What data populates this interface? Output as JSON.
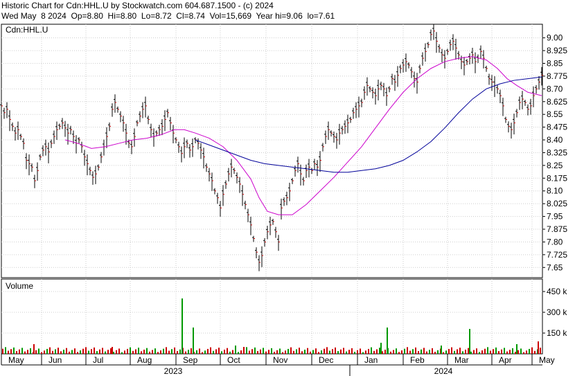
{
  "header": {
    "line1": "Historic Chart for Cdn:HHL.U by Stockwatch.com 604.687.1500 - (c) 2024",
    "line2": "Wed May  8 2024  Op=8.80  Hi=8.80  Lo=8.72  Cl=8.74  Vol=15,669  Year hi=9.06  lo=7.61"
  },
  "chart_data": [
    {
      "type": "line",
      "title": "Cdn:HHL.U",
      "y_ticks": [
        "9.00",
        "8.925",
        "8.85",
        "8.775",
        "8.70",
        "8.625",
        "8.55",
        "8.475",
        "8.40",
        "8.325",
        "8.25",
        "8.175",
        "8.10",
        "8.025",
        "7.95",
        "7.875",
        "7.80",
        "7.725",
        "7.65"
      ],
      "ylim": [
        7.59,
        9.08
      ],
      "x_months": [
        "May",
        "Jun",
        "Jul",
        "Aug",
        "Sep",
        "Oct",
        "Nov",
        "Dec",
        "Jan",
        "Feb",
        "Mar",
        "Apr",
        "May"
      ],
      "x_years": [
        "2023",
        "2024"
      ],
      "grid": true,
      "series": [
        {
          "name": "",
          "style": "ohlc-bars",
          "color": "#000000",
          "close_color": "#cc0000",
          "points": [
            [
              0,
              8.6
            ],
            [
              4,
              8.56
            ],
            [
              8,
              8.58
            ],
            [
              12,
              8.52
            ],
            [
              16,
              8.48
            ],
            [
              20,
              8.44
            ],
            [
              24,
              8.46
            ],
            [
              28,
              8.42
            ],
            [
              32,
              8.38
            ],
            [
              36,
              8.28
            ],
            [
              40,
              8.26
            ],
            [
              44,
              8.24
            ],
            [
              48,
              8.16
            ],
            [
              52,
              8.22
            ],
            [
              56,
              8.3
            ],
            [
              60,
              8.34
            ],
            [
              64,
              8.36
            ],
            [
              68,
              8.33
            ],
            [
              72,
              8.38
            ],
            [
              76,
              8.42
            ],
            [
              80,
              8.46
            ],
            [
              84,
              8.48
            ],
            [
              88,
              8.5
            ],
            [
              92,
              8.47
            ],
            [
              96,
              8.44
            ],
            [
              100,
              8.46
            ],
            [
              104,
              8.42
            ],
            [
              108,
              8.38
            ],
            [
              112,
              8.4
            ],
            [
              116,
              8.36
            ],
            [
              120,
              8.3
            ],
            [
              124,
              8.26
            ],
            [
              128,
              8.22
            ],
            [
              132,
              8.18
            ],
            [
              136,
              8.2
            ],
            [
              140,
              8.24
            ],
            [
              144,
              8.3
            ],
            [
              148,
              8.36
            ],
            [
              152,
              8.42
            ],
            [
              156,
              8.48
            ],
            [
              160,
              8.58
            ],
            [
              164,
              8.62
            ],
            [
              168,
              8.58
            ],
            [
              172,
              8.54
            ],
            [
              176,
              8.5
            ],
            [
              180,
              8.44
            ],
            [
              184,
              8.38
            ],
            [
              188,
              8.36
            ],
            [
              192,
              8.42
            ],
            [
              196,
              8.5
            ],
            [
              200,
              8.54
            ],
            [
              204,
              8.58
            ],
            [
              208,
              8.6
            ],
            [
              212,
              8.52
            ],
            [
              216,
              8.46
            ],
            [
              220,
              8.42
            ],
            [
              224,
              8.44
            ],
            [
              228,
              8.46
            ],
            [
              232,
              8.48
            ],
            [
              236,
              8.52
            ],
            [
              240,
              8.56
            ],
            [
              244,
              8.5
            ],
            [
              248,
              8.44
            ],
            [
              252,
              8.4
            ],
            [
              256,
              8.36
            ],
            [
              260,
              8.32
            ],
            [
              264,
              8.36
            ],
            [
              268,
              8.38
            ],
            [
              272,
              8.34
            ],
            [
              276,
              8.36
            ],
            [
              280,
              8.4
            ],
            [
              284,
              8.38
            ],
            [
              288,
              8.34
            ],
            [
              292,
              8.3
            ],
            [
              296,
              8.24
            ],
            [
              300,
              8.2
            ],
            [
              304,
              8.16
            ],
            [
              308,
              8.1
            ],
            [
              312,
              8.06
            ],
            [
              316,
              8.0
            ],
            [
              320,
              8.08
            ],
            [
              324,
              8.14
            ],
            [
              328,
              8.2
            ],
            [
              332,
              8.24
            ],
            [
              336,
              8.22
            ],
            [
              340,
              8.18
            ],
            [
              344,
              8.14
            ],
            [
              348,
              8.08
            ],
            [
              352,
              8.02
            ],
            [
              356,
              7.96
            ],
            [
              360,
              7.9
            ],
            [
              364,
              7.82
            ],
            [
              368,
              7.74
            ],
            [
              372,
              7.68
            ],
            [
              376,
              7.72
            ],
            [
              380,
              7.8
            ],
            [
              384,
              7.86
            ],
            [
              388,
              7.9
            ],
            [
              392,
              7.92
            ],
            [
              396,
              7.86
            ],
            [
              400,
              7.8
            ],
            [
              404,
              8.0
            ],
            [
              408,
              8.04
            ],
            [
              412,
              8.06
            ],
            [
              416,
              8.1
            ],
            [
              420,
              8.16
            ],
            [
              424,
              8.22
            ],
            [
              428,
              8.26
            ],
            [
              432,
              8.2
            ],
            [
              436,
              8.16
            ],
            [
              440,
              8.22
            ],
            [
              444,
              8.24
            ],
            [
              448,
              8.22
            ],
            [
              452,
              8.26
            ],
            [
              456,
              8.24
            ],
            [
              460,
              8.28
            ],
            [
              464,
              8.36
            ],
            [
              468,
              8.42
            ],
            [
              472,
              8.46
            ],
            [
              476,
              8.44
            ],
            [
              480,
              8.42
            ],
            [
              484,
              8.4
            ],
            [
              488,
              8.44
            ],
            [
              492,
              8.46
            ],
            [
              496,
              8.48
            ],
            [
              500,
              8.5
            ],
            [
              504,
              8.52
            ],
            [
              508,
              8.56
            ],
            [
              512,
              8.58
            ],
            [
              516,
              8.6
            ],
            [
              520,
              8.62
            ],
            [
              524,
              8.68
            ],
            [
              528,
              8.72
            ],
            [
              532,
              8.7
            ],
            [
              536,
              8.68
            ],
            [
              540,
              8.66
            ],
            [
              544,
              8.7
            ],
            [
              548,
              8.72
            ],
            [
              552,
              8.7
            ],
            [
              556,
              8.66
            ],
            [
              560,
              8.7
            ],
            [
              564,
              8.76
            ],
            [
              568,
              8.74
            ],
            [
              572,
              8.78
            ],
            [
              576,
              8.82
            ],
            [
              580,
              8.84
            ],
            [
              584,
              8.86
            ],
            [
              588,
              8.84
            ],
            [
              592,
              8.8
            ],
            [
              596,
              8.76
            ],
            [
              600,
              8.74
            ],
            [
              604,
              8.82
            ],
            [
              608,
              8.88
            ],
            [
              612,
              8.92
            ],
            [
              616,
              8.96
            ],
            [
              620,
              9.02
            ],
            [
              624,
              9.04
            ],
            [
              628,
              8.98
            ],
            [
              632,
              8.94
            ],
            [
              636,
              8.9
            ],
            [
              640,
              8.88
            ],
            [
              644,
              8.92
            ],
            [
              648,
              8.96
            ],
            [
              652,
              8.98
            ],
            [
              656,
              8.94
            ],
            [
              660,
              8.9
            ],
            [
              664,
              8.86
            ],
            [
              668,
              8.84
            ],
            [
              672,
              8.86
            ],
            [
              676,
              8.88
            ],
            [
              680,
              8.9
            ],
            [
              684,
              8.86
            ],
            [
              688,
              8.88
            ],
            [
              692,
              8.92
            ],
            [
              696,
              8.88
            ],
            [
              700,
              8.82
            ],
            [
              704,
              8.76
            ],
            [
              708,
              8.74
            ],
            [
              712,
              8.72
            ],
            [
              716,
              8.7
            ],
            [
              720,
              8.66
            ],
            [
              724,
              8.6
            ],
            [
              728,
              8.52
            ],
            [
              732,
              8.48
            ],
            [
              736,
              8.46
            ],
            [
              740,
              8.5
            ],
            [
              744,
              8.56
            ],
            [
              748,
              8.62
            ],
            [
              752,
              8.64
            ],
            [
              756,
              8.62
            ],
            [
              760,
              8.58
            ],
            [
              764,
              8.6
            ],
            [
              768,
              8.66
            ],
            [
              772,
              8.7
            ],
            [
              776,
              8.74
            ],
            [
              780,
              8.78
            ]
          ]
        },
        {
          "name": "",
          "style": "moving-average",
          "color": "#cc00cc",
          "points": [
            [
              92,
              8.4
            ],
            [
              110,
              8.38
            ],
            [
              130,
              8.35
            ],
            [
              150,
              8.36
            ],
            [
              170,
              8.38
            ],
            [
              190,
              8.4
            ],
            [
              210,
              8.41
            ],
            [
              230,
              8.43
            ],
            [
              250,
              8.46
            ],
            [
              264,
              8.46
            ],
            [
              280,
              8.44
            ],
            [
              300,
              8.41
            ],
            [
              320,
              8.36
            ],
            [
              340,
              8.28
            ],
            [
              360,
              8.17
            ],
            [
              372,
              8.06
            ],
            [
              384,
              7.98
            ],
            [
              400,
              7.96
            ],
            [
              420,
              7.96
            ],
            [
              440,
              8.02
            ],
            [
              460,
              8.1
            ],
            [
              480,
              8.18
            ],
            [
              500,
              8.27
            ],
            [
              520,
              8.36
            ],
            [
              540,
              8.47
            ],
            [
              560,
              8.58
            ],
            [
              580,
              8.68
            ],
            [
              600,
              8.76
            ],
            [
              620,
              8.82
            ],
            [
              640,
              8.86
            ],
            [
              660,
              8.88
            ],
            [
              680,
              8.89
            ],
            [
              700,
              8.87
            ],
            [
              716,
              8.82
            ],
            [
              730,
              8.76
            ],
            [
              744,
              8.72
            ],
            [
              760,
              8.68
            ],
            [
              780,
              8.66
            ]
          ]
        },
        {
          "name": "",
          "style": "moving-average",
          "color": "#000099",
          "points": [
            [
              280,
              8.4
            ],
            [
              300,
              8.37
            ],
            [
              320,
              8.34
            ],
            [
              340,
              8.31
            ],
            [
              360,
              8.28
            ],
            [
              380,
              8.26
            ],
            [
              400,
              8.25
            ],
            [
              420,
              8.24
            ],
            [
              440,
              8.23
            ],
            [
              460,
              8.22
            ],
            [
              480,
              8.21
            ],
            [
              500,
              8.21
            ],
            [
              520,
              8.22
            ],
            [
              540,
              8.23
            ],
            [
              560,
              8.25
            ],
            [
              580,
              8.28
            ],
            [
              600,
              8.33
            ],
            [
              620,
              8.39
            ],
            [
              640,
              8.47
            ],
            [
              660,
              8.56
            ],
            [
              680,
              8.64
            ],
            [
              700,
              8.7
            ],
            [
              720,
              8.73
            ],
            [
              740,
              8.75
            ],
            [
              760,
              8.76
            ],
            [
              780,
              8.77
            ]
          ]
        }
      ]
    },
    {
      "type": "bar",
      "title": "Volume",
      "y_ticks": [
        "450 k",
        "300 k",
        "150 k"
      ],
      "ylim": [
        0,
        540000
      ],
      "color_up": "#009900",
      "color_down": "#cc0000",
      "spikes": [
        [
          261,
          400000,
          "up"
        ],
        [
          277,
          190000,
          "up"
        ],
        [
          338,
          60000,
          "up"
        ],
        [
          557,
          190000,
          "up"
        ],
        [
          676,
          180000,
          "up"
        ],
        [
          47,
          70000,
          "down"
        ],
        [
          160,
          50000,
          "down"
        ],
        [
          350,
          50000,
          "down"
        ],
        [
          548,
          80000,
          "up"
        ],
        [
          635,
          60000,
          "up"
        ],
        [
          744,
          70000,
          "up"
        ],
        [
          775,
          90000,
          "down"
        ]
      ]
    }
  ]
}
